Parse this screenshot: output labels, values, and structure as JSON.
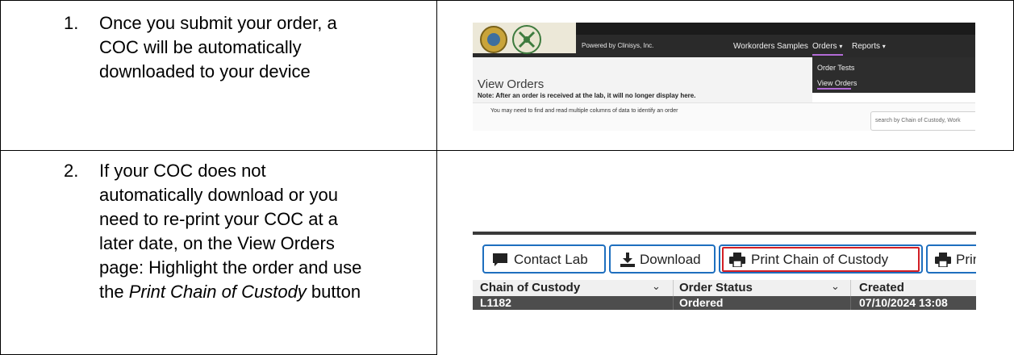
{
  "steps": [
    {
      "number": "1.",
      "lines": [
        "Once you submit your order, a",
        "COC will be automatically",
        "downloaded to your device"
      ]
    },
    {
      "number": "2.",
      "lines": [
        "If your COC does not",
        "automatically download or you",
        "need to re-print your COC at a",
        "later date, on the View Orders",
        "page: Highlight the order and use"
      ],
      "last_line_prefix": "the ",
      "last_line_italic": "Print Chain of Custody",
      "last_line_suffix": " button"
    }
  ],
  "screenshot1": {
    "powered_by": "Powered by Clinisys, Inc.",
    "nav": {
      "workorders": "Workorders",
      "samples": "Samples",
      "orders": "Orders",
      "reports": "Reports",
      "caret": "▾"
    },
    "orders_menu": [
      "Order Tests",
      "View Orders"
    ],
    "page_title": "View Orders",
    "note": "Note: After an order is received at the lab, it will no longer display here.",
    "hint": "You may need to find and read multiple columns of data to identify an order",
    "search_placeholder": "search by Chain of Custody, Work"
  },
  "screenshot2": {
    "buttons": {
      "contact_lab": "Contact Lab",
      "download": "Download",
      "print_coc": "Print Chain of Custody",
      "print_partial": "Prin"
    },
    "columns": [
      "Chain of Custody",
      "Order Status",
      "Created"
    ],
    "row": [
      "L1182",
      "Ordered",
      "07/10/2024 13:08"
    ],
    "chevron": "⌄",
    "icons": {
      "comment": "comment-icon",
      "download": "download-icon",
      "print": "print-icon"
    }
  },
  "colors": {
    "border_blue": "#1e6fbf",
    "highlight_red": "#d21f26",
    "menu_accent": "#b26bd6"
  }
}
